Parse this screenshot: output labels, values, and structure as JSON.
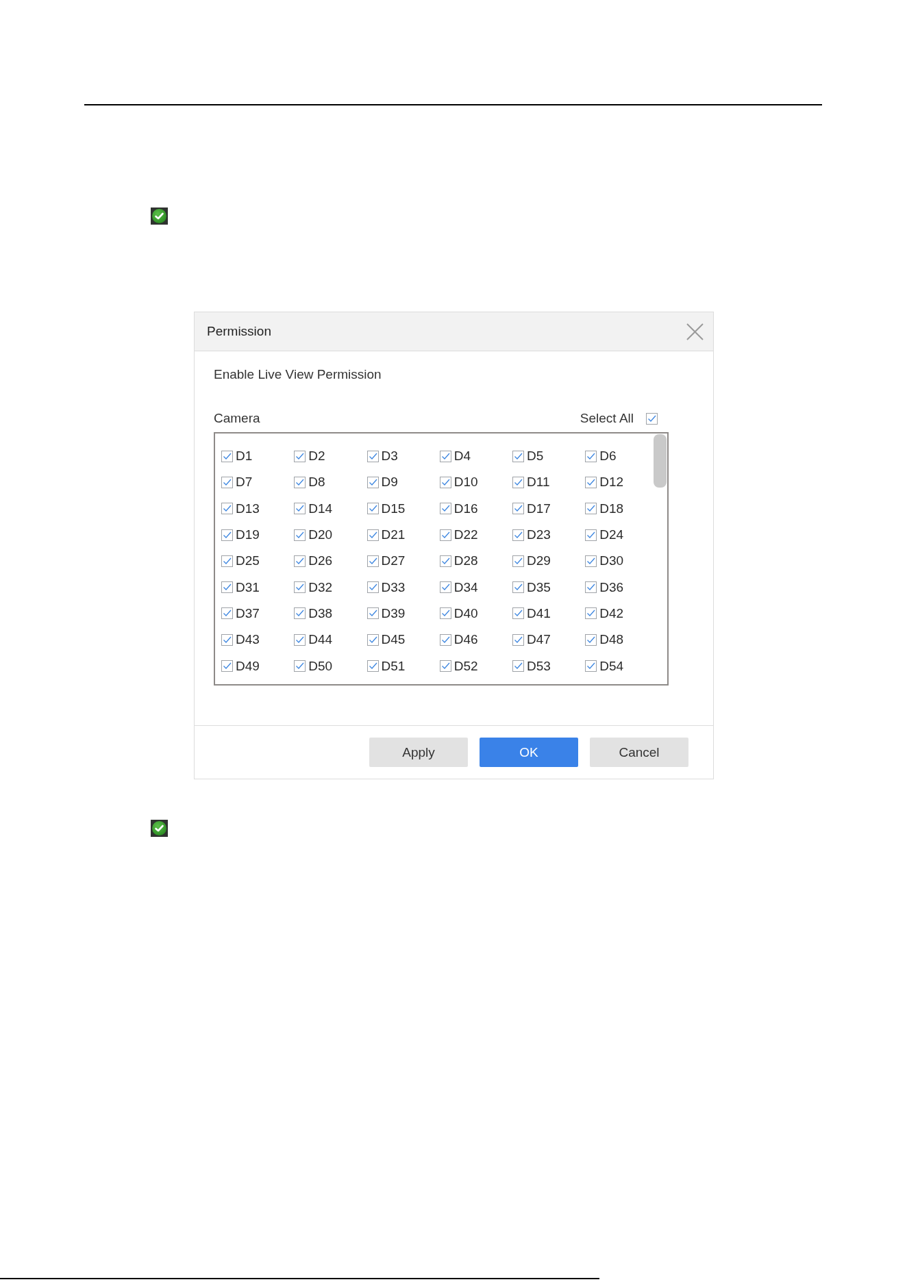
{
  "dialog": {
    "title": "Permission",
    "section_label": "Enable Live View Permission",
    "camera_label": "Camera",
    "select_all": {
      "label": "Select All",
      "checked": true
    },
    "cameras": [
      {
        "label": "D1",
        "checked": true
      },
      {
        "label": "D2",
        "checked": true
      },
      {
        "label": "D3",
        "checked": true
      },
      {
        "label": "D4",
        "checked": true
      },
      {
        "label": "D5",
        "checked": true
      },
      {
        "label": "D6",
        "checked": true
      },
      {
        "label": "D7",
        "checked": true
      },
      {
        "label": "D8",
        "checked": true
      },
      {
        "label": "D9",
        "checked": true
      },
      {
        "label": "D10",
        "checked": true
      },
      {
        "label": "D11",
        "checked": true
      },
      {
        "label": "D12",
        "checked": true
      },
      {
        "label": "D13",
        "checked": true
      },
      {
        "label": "D14",
        "checked": true
      },
      {
        "label": "D15",
        "checked": true
      },
      {
        "label": "D16",
        "checked": true
      },
      {
        "label": "D17",
        "checked": true
      },
      {
        "label": "D18",
        "checked": true
      },
      {
        "label": "D19",
        "checked": true
      },
      {
        "label": "D20",
        "checked": true
      },
      {
        "label": "D21",
        "checked": true
      },
      {
        "label": "D22",
        "checked": true
      },
      {
        "label": "D23",
        "checked": true
      },
      {
        "label": "D24",
        "checked": true
      },
      {
        "label": "D25",
        "checked": true
      },
      {
        "label": "D26",
        "checked": true
      },
      {
        "label": "D27",
        "checked": true
      },
      {
        "label": "D28",
        "checked": true
      },
      {
        "label": "D29",
        "checked": true
      },
      {
        "label": "D30",
        "checked": true
      },
      {
        "label": "D31",
        "checked": true
      },
      {
        "label": "D32",
        "checked": true
      },
      {
        "label": "D33",
        "checked": true
      },
      {
        "label": "D34",
        "checked": true
      },
      {
        "label": "D35",
        "checked": true
      },
      {
        "label": "D36",
        "checked": true
      },
      {
        "label": "D37",
        "checked": true
      },
      {
        "label": "D38",
        "checked": true
      },
      {
        "label": "D39",
        "checked": true
      },
      {
        "label": "D40",
        "checked": true
      },
      {
        "label": "D41",
        "checked": true
      },
      {
        "label": "D42",
        "checked": true
      },
      {
        "label": "D43",
        "checked": true
      },
      {
        "label": "D44",
        "checked": true
      },
      {
        "label": "D45",
        "checked": true
      },
      {
        "label": "D46",
        "checked": true
      },
      {
        "label": "D47",
        "checked": true
      },
      {
        "label": "D48",
        "checked": true
      },
      {
        "label": "D49",
        "checked": true
      },
      {
        "label": "D50",
        "checked": true
      },
      {
        "label": "D51",
        "checked": true
      },
      {
        "label": "D52",
        "checked": true
      },
      {
        "label": "D53",
        "checked": true
      },
      {
        "label": "D54",
        "checked": true
      }
    ],
    "buttons": [
      {
        "label": "Apply",
        "kind": "secondary"
      },
      {
        "label": "OK",
        "kind": "primary"
      },
      {
        "label": "Cancel",
        "kind": "secondary"
      }
    ]
  }
}
